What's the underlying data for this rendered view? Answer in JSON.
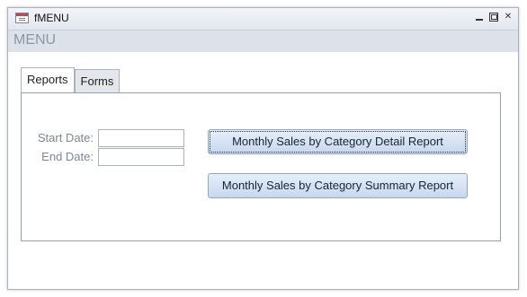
{
  "window": {
    "title": "fMENU"
  },
  "header": {
    "title": "MENU"
  },
  "tabs": [
    {
      "label": "Reports",
      "active": true
    },
    {
      "label": "Forms",
      "active": false
    }
  ],
  "form": {
    "start_date": {
      "label": "Start Date:",
      "value": ""
    },
    "end_date": {
      "label": "End Date:",
      "value": ""
    }
  },
  "buttons": {
    "detail_report": "Monthly Sales by Category Detail Report",
    "summary_report": "Monthly Sales by Category Summary Report"
  },
  "colors": {
    "header_band": "#dde2ea",
    "button_fill": "#c6d7ee",
    "button_border": "#8ea9c8"
  }
}
